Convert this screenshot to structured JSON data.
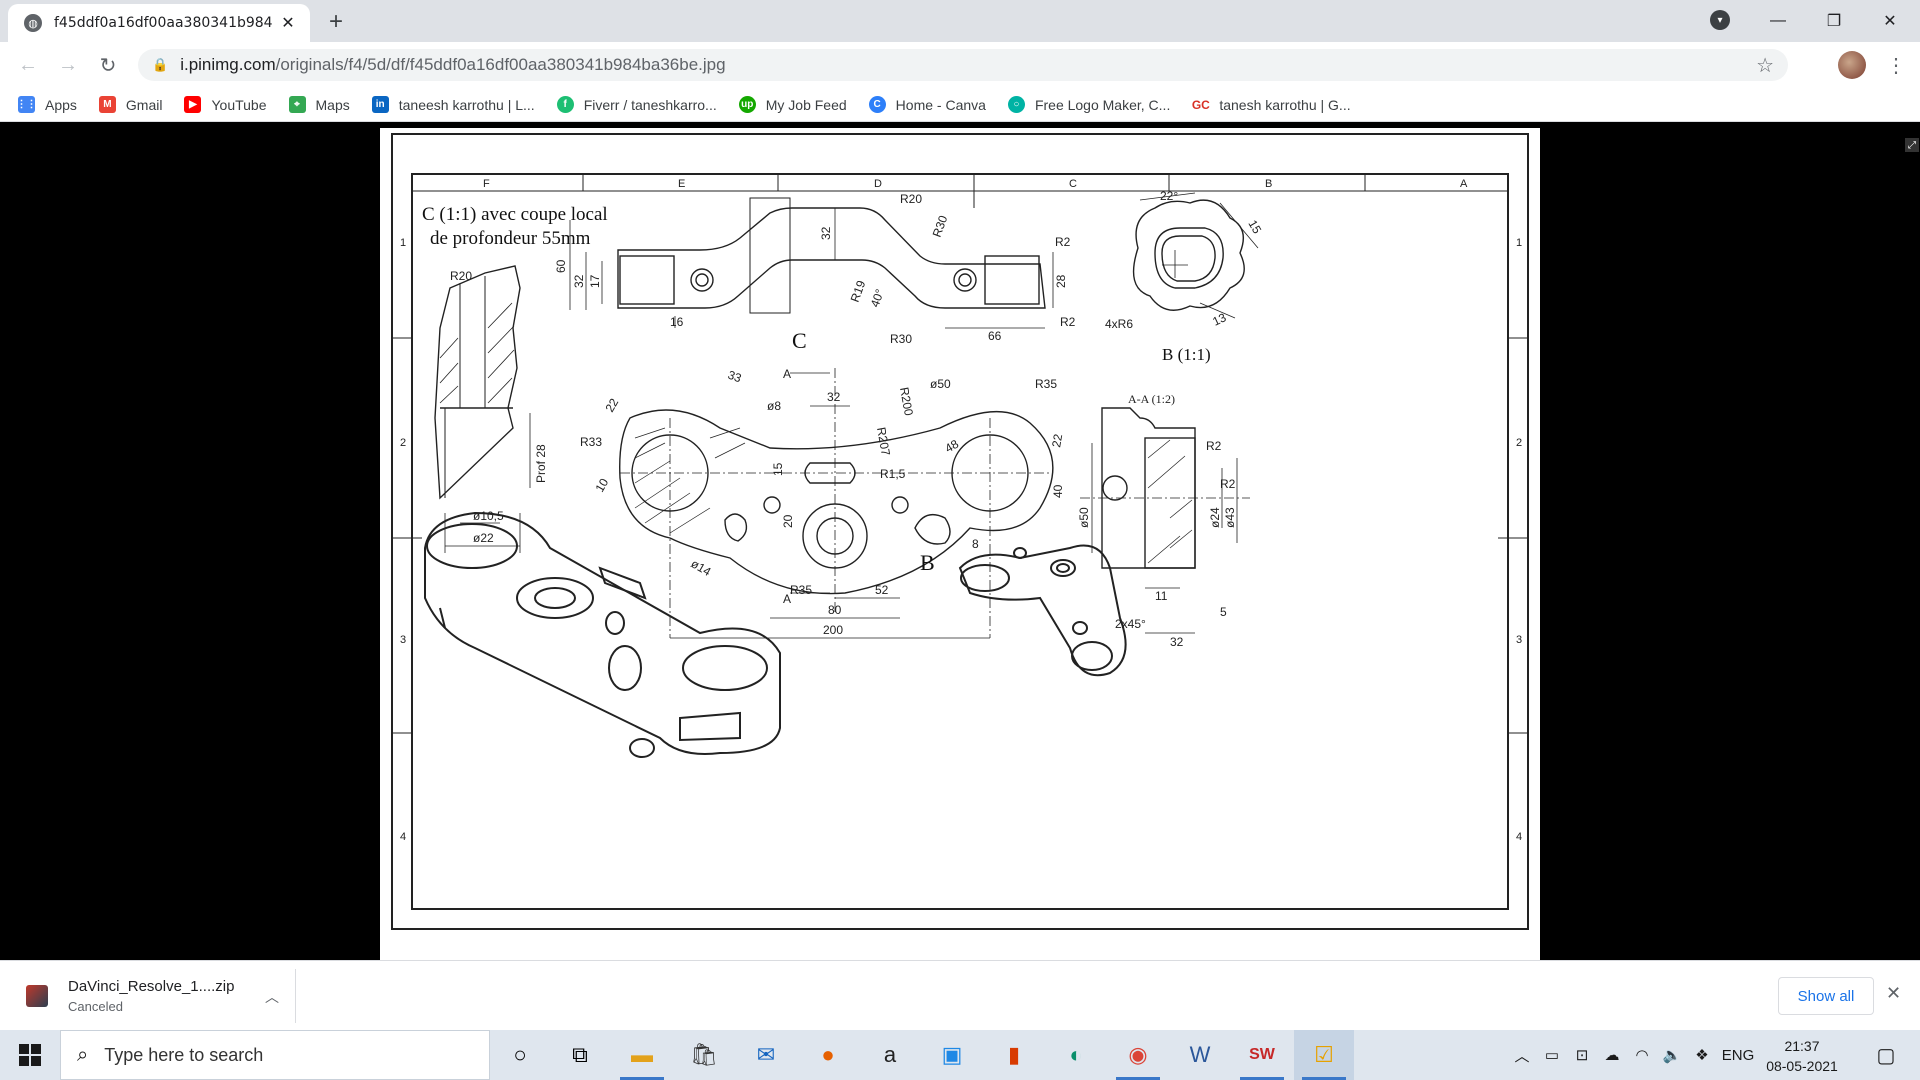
{
  "browser": {
    "tab": {
      "title": "f45ddf0a16df00aa380341b984ba",
      "favicon": "globe-icon"
    },
    "window_controls": [
      "minimize",
      "restore",
      "close"
    ],
    "omnibox": {
      "host": "i.pinimg.com",
      "path": "/originals/f4/5d/df/f45ddf0a16df00aa380341b984ba36be.jpg"
    },
    "bookmarks": [
      {
        "label": "Apps",
        "icon": "apps-grid-icon",
        "color": "#4285f4"
      },
      {
        "label": "Gmail",
        "icon": "gmail-icon",
        "color": "#ea4335"
      },
      {
        "label": "YouTube",
        "icon": "youtube-icon",
        "color": "#ff0000"
      },
      {
        "label": "Maps",
        "icon": "maps-icon",
        "color": "#34a853"
      },
      {
        "label": "taneesh karrothu | L...",
        "icon": "linkedin-icon",
        "color": "#0a66c2"
      },
      {
        "label": "Fiverr / taneshkarro...",
        "icon": "fiverr-icon",
        "color": "#1dbf73"
      },
      {
        "label": "My Job Feed",
        "icon": "upwork-icon",
        "color": "#14a800"
      },
      {
        "label": "Home - Canva",
        "icon": "canva-icon",
        "color": "#00c4cc"
      },
      {
        "label": "Free Logo Maker, C...",
        "icon": "logo-maker-icon",
        "color": "#00b3a4"
      },
      {
        "label": "tanesh karrothu | G...",
        "icon": "gc-icon",
        "color": "#d93025"
      }
    ]
  },
  "drawing": {
    "title_line1": "C (1:1) avec coupe local",
    "title_line2": "de profondeur 55mm",
    "columns": [
      "F",
      "E",
      "D",
      "C",
      "B",
      "A"
    ],
    "rows": [
      "1",
      "2",
      "3",
      "4"
    ],
    "labels": {
      "C": "C",
      "B": "B",
      "B_view": "B (1:1)",
      "AA_view": "A-A (1:2)",
      "A_top": "A",
      "A_bottom": "A",
      "d_R20a": "R20",
      "d_R20b": "R20",
      "d_R30a": "R30",
      "d_R30b": "R30",
      "d_R2a": "R2",
      "d_R2b": "R2",
      "d_R19": "R19",
      "d_40deg": "40°",
      "d_60": "60",
      "d_32a": "32",
      "d_17": "17",
      "d_16": "16",
      "d_32b": "32",
      "d_28a": "28",
      "d_66": "66",
      "d_22deg": "22°",
      "d_15": "15",
      "d_13": "13",
      "d_4xR6": "4xR6",
      "d_prof28": "Prof 28",
      "d_phi105": "ø10,5",
      "d_phi22": "ø22",
      "d_33": "33",
      "d_22a": "22",
      "d_phi8": "ø8",
      "d_32c": "32",
      "d_R207": "R207",
      "d_R200": "R200",
      "d_phi50a": "ø50",
      "d_R35a": "R35",
      "d_R33": "R33",
      "d_10": "10",
      "d_15b": "15",
      "d_48": "48",
      "d_R15": "R1,5",
      "d_22b": "22",
      "d_40": "40",
      "d_20": "20",
      "d_phi14": "ø14",
      "d_8": "8",
      "d_R35b": "R35",
      "d_52": "52",
      "d_80": "80",
      "d_200": "200",
      "d_R2c": "R2",
      "d_R2d": "R2",
      "d_phi50b": "ø50",
      "d_phi24": "ø24",
      "d_phi43": "ø43",
      "d_11": "11",
      "d_5": "5",
      "d_2x45": "2x45°",
      "d_32d": "32"
    }
  },
  "download": {
    "filename": "DaVinci_Resolve_1....zip",
    "status": "Canceled",
    "show_all": "Show all"
  },
  "taskbar": {
    "search_placeholder": "Type here to search",
    "apps": [
      "cortana-icon",
      "task-view-icon",
      "file-explorer-icon",
      "store-icon",
      "mail-icon",
      "firefox-icon",
      "amazon-icon",
      "remote-desktop-icon",
      "office-icon",
      "edge-icon",
      "chrome-icon",
      "word-icon",
      "solidworks-icon",
      "tasks-icon"
    ],
    "language": "ENG",
    "time": "21:37",
    "date": "08-05-2021"
  }
}
